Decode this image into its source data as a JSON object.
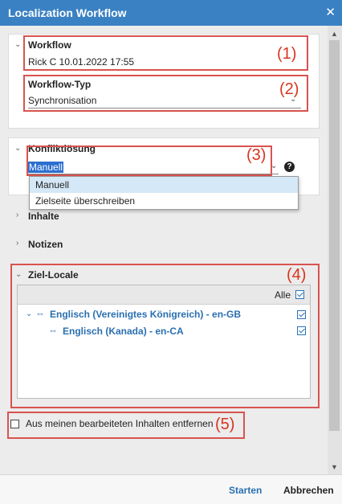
{
  "window": {
    "title": "Localization Workflow",
    "close_icon": "close-icon"
  },
  "workflow": {
    "label": "Workflow",
    "value": "Rick C 10.01.2022 17:55",
    "annotation": "(1)"
  },
  "workflow_type": {
    "label": "Workflow-Typ",
    "value": "Synchronisation",
    "annotation": "(2)"
  },
  "conflict": {
    "label": "Konfliktlösung",
    "value": "Manuell",
    "annotation": "(3)",
    "help": "?",
    "options": [
      "Manuell",
      "Zielseite überschreiben"
    ]
  },
  "sections": {
    "inhalte": "Inhalte",
    "notizen": "Notizen"
  },
  "target_locales": {
    "label": "Ziel-Locale",
    "annotation": "(4)",
    "all_label": "Alle",
    "items": [
      {
        "name": "Englisch (Vereinigtes Königreich) - en-GB",
        "checked": true
      },
      {
        "name": "Englisch (Kanada) - en-CA",
        "checked": true
      }
    ]
  },
  "remove_option": {
    "label": "Aus meinen bearbeiteten Inhalten entfernen",
    "checked": false,
    "annotation": "(5)"
  },
  "footer": {
    "start_label": "Starten",
    "cancel_label": "Abbrechen"
  },
  "colors": {
    "titlebar": "#3a81c3",
    "accent": "#2a6fb0",
    "annotation_red": "#d9341f"
  }
}
